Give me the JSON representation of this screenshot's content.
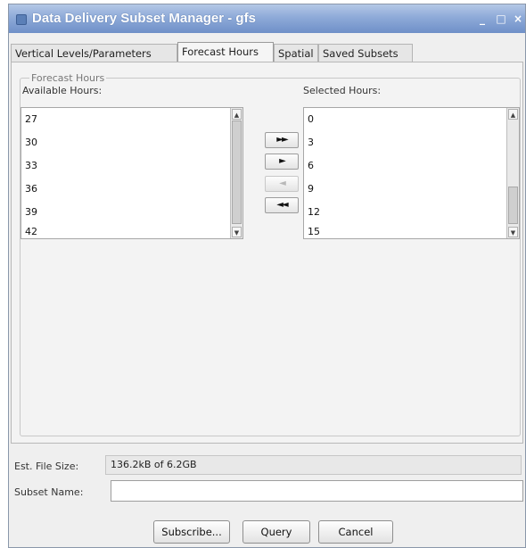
{
  "window": {
    "title": "Data Delivery Subset Manager - gfs",
    "controls": {
      "minimize": "_",
      "maximize": "□",
      "close": "×"
    }
  },
  "tabs": [
    {
      "label": "Vertical Levels/Parameters",
      "active": false
    },
    {
      "label": "Forecast Hours",
      "active": true
    },
    {
      "label": "Spatial",
      "active": false
    },
    {
      "label": "Saved Subsets",
      "active": false
    }
  ],
  "forecast_group": {
    "legend": "Forecast Hours",
    "available_label": "Available Hours:",
    "selected_label": "Selected Hours:",
    "available_hours": [
      "27",
      "30",
      "33",
      "36",
      "39",
      "42"
    ],
    "selected_hours": [
      "0",
      "3",
      "6",
      "9",
      "12",
      "15"
    ]
  },
  "move_buttons": {
    "add_all": "►►",
    "add": "►",
    "remove": "◄",
    "remove_all": "◄◄"
  },
  "footer": {
    "file_size_label": "Est. File Size:",
    "file_size_value": "136.2kB of 6.2GB",
    "subset_name_label": "Subset Name:",
    "subset_name_value": "",
    "subscribe_label": "Subscribe...",
    "query_label": "Query",
    "cancel_label": "Cancel"
  },
  "colors": {
    "title_bar": "#7f9dd0",
    "window_bg": "#efefef"
  }
}
